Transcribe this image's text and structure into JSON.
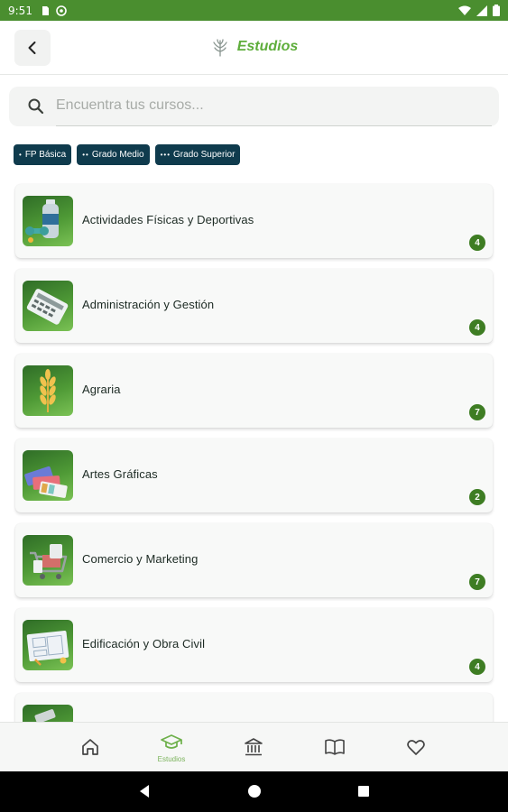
{
  "status_bar": {
    "time": "9:51"
  },
  "app_bar": {
    "title": "Estudios"
  },
  "search": {
    "placeholder": "Encuentra tus cursos..."
  },
  "filters": [
    {
      "dots": "•",
      "label": "FP Básica"
    },
    {
      "dots": "••",
      "label": "Grado Medio"
    },
    {
      "dots": "•••",
      "label": "Grado Superior"
    }
  ],
  "categories": [
    {
      "title": "Actividades Físicas y Deportivas",
      "count": "4",
      "icon": "sport-bottle-dumbbell-icon"
    },
    {
      "title": "Administración y Gestión",
      "count": "4",
      "icon": "calculator-icon"
    },
    {
      "title": "Agraria",
      "count": "7",
      "icon": "wheat-icon"
    },
    {
      "title": "Artes Gráficas",
      "count": "2",
      "icon": "color-swatch-icon"
    },
    {
      "title": "Comercio y Marketing",
      "count": "7",
      "icon": "shopping-cart-icon"
    },
    {
      "title": "Edificación y Obra Civil",
      "count": "4",
      "icon": "blueprint-icon"
    }
  ],
  "bottom_nav": [
    {
      "name": "home",
      "label": ""
    },
    {
      "name": "estudios",
      "label": "Estudios"
    },
    {
      "name": "institutions",
      "label": ""
    },
    {
      "name": "book",
      "label": ""
    },
    {
      "name": "favorites",
      "label": ""
    }
  ],
  "colors": {
    "status_bar": "#4a8e2f",
    "accent": "#5fae3c",
    "chip": "#0f3b4d",
    "badge": "#3e7d23"
  }
}
